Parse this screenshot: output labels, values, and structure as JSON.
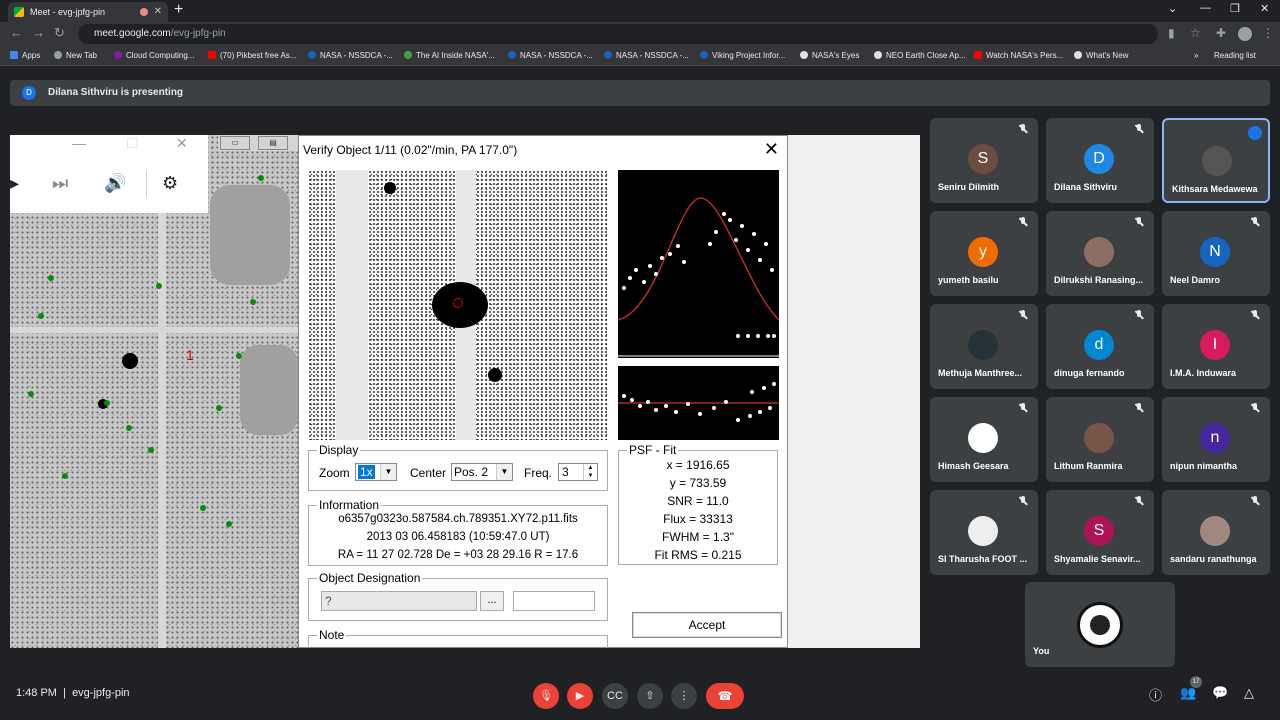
{
  "browser": {
    "tab_title": "Meet - evg-jpfg-pin",
    "url_host": "meet.google.com",
    "url_path": "/evg-jpfg-pin",
    "bookmarks": [
      "Apps",
      "New Tab",
      "Cloud Computing...",
      "(70) Pikbest free As...",
      "NASA - NSSDCA -...",
      "The AI Inside NASA'...",
      "NASA - NSSDCA -...",
      "NASA - NSSDCA -...",
      "Viking Project Infor...",
      "NASA's Eyes",
      "NEO Earth Close Ap...",
      "Watch NASA's Pers...",
      "What's New"
    ],
    "reading_list": "Reading list"
  },
  "meet": {
    "presenting_text": "Dilana Sithviru is presenting",
    "presenter_initial": "D",
    "time": "1:48 PM",
    "meeting_code": "evg-jpfg-pin",
    "participant_count": "17"
  },
  "dialog": {
    "title": "Verify Object 1/11 (0.02\"/min, PA 177.0\")",
    "display": {
      "legend": "Display",
      "zoom_label": "Zoom",
      "zoom_value": "1x",
      "center_label": "Center",
      "center_value": "Pos. 2",
      "freq_label": "Freq.",
      "freq_value": "3"
    },
    "psf": {
      "legend": "PSF - Fit",
      "x": "x = 1916.65",
      "y": "y = 733.59",
      "snr": "SNR = 11.0",
      "flux": "Flux = 33313",
      "fwhm": "FWHM = 1.3\"",
      "fit_rms": "Fit RMS = 0.215"
    },
    "information": {
      "legend": "Information",
      "file": "o6357g0323o.587584.ch.789351.XY72.p11.fits",
      "date": "2013 03 06.458183 (10:59:47.0 UT)",
      "coords": "RA = 11 27 02.728   De = +03 28 29.16   R = 17.6"
    },
    "designation": {
      "legend": "Object Designation",
      "value": "?",
      "browse": "..."
    },
    "note_legend": "Note",
    "accept": "Accept"
  },
  "participants": [
    {
      "name": "Seniru Dilmith",
      "initial": "S",
      "color": "#6d4c41"
    },
    {
      "name": "Dilana Sithviru",
      "initial": "D",
      "color": "#1e88e5"
    },
    {
      "name": "Kithsara Medawewa",
      "initial": "",
      "color": "#555555"
    },
    {
      "name": "yumeth basilu",
      "initial": "y",
      "color": "#ef6c00"
    },
    {
      "name": "Dilrukshi Ranasing...",
      "initial": "",
      "color": "#8d6e63"
    },
    {
      "name": "Neel Damro",
      "initial": "N",
      "color": "#1565c0"
    },
    {
      "name": "Methuja Manthree...",
      "initial": "",
      "color": "#263238"
    },
    {
      "name": "dinuga fernando",
      "initial": "d",
      "color": "#0288d1"
    },
    {
      "name": "I.M.A. Induwara",
      "initial": "I",
      "color": "#d81b60"
    },
    {
      "name": "Himash Geesara",
      "initial": "",
      "color": "#ffffff"
    },
    {
      "name": "Lithum Ranmira",
      "initial": "",
      "color": "#795548"
    },
    {
      "name": "nipun nimantha",
      "initial": "n",
      "color": "#4527a0"
    },
    {
      "name": "SI Tharusha FOOT ...",
      "initial": "",
      "color": "#eeeeee"
    },
    {
      "name": "Shyamalie Senavir...",
      "initial": "S",
      "color": "#ad1457"
    },
    {
      "name": "sandaru ranathunga",
      "initial": "",
      "color": "#a1887f"
    }
  ],
  "you_label": "You"
}
